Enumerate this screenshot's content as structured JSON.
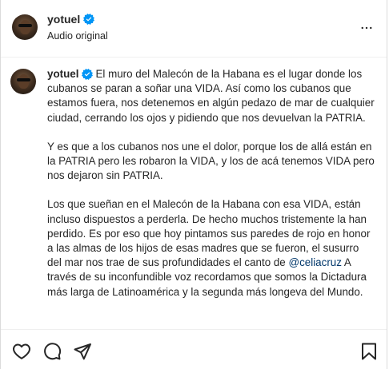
{
  "post": {
    "username": "yotuel",
    "audio_label": "Audio original",
    "caption": {
      "username": "yotuel",
      "para1_before": "El muro del Malecón de la Habana es el lugar donde los cubanos se paran a soñar una VIDA. Así como los cubanos que estamos fuera, nos detenemos en algún pedazo de mar de cualquier ciudad, cerrando los ojos y pidiendo que nos devuelvan la PATRIA.",
      "para2": "Y es que a los cubanos nos une el dolor, porque los de allá están en la PATRIA pero les robaron la VIDA, y los de acá tenemos VIDA pero nos dejaron sin PATRIA.",
      "para3_before": "Los que sueñan en el Malecón de la Habana con esa VIDA, están incluso dispuestos a perderla. De hecho muchos tristemente la han perdido. Es por eso que hoy pintamos sus paredes de rojo en honor a las almas de los hijos de esas madres que se fueron, el susurro del mar nos trae de sus profundidades el canto de ",
      "mention": "@celiacruz",
      "para3_after": " A través de su inconfundible voz recordamos que somos la Dictadura más larga de Latinoamérica y la segunda más longeva del Mundo."
    }
  },
  "icons": {
    "verified": "verified-badge-icon",
    "more": "more-options-icon",
    "like": "heart-icon",
    "comment": "comment-icon",
    "share": "share-icon",
    "save": "bookmark-icon"
  },
  "colors": {
    "verified": "#0095f6",
    "text": "#262626",
    "mention": "#00376b",
    "border": "#dbdbdb"
  }
}
